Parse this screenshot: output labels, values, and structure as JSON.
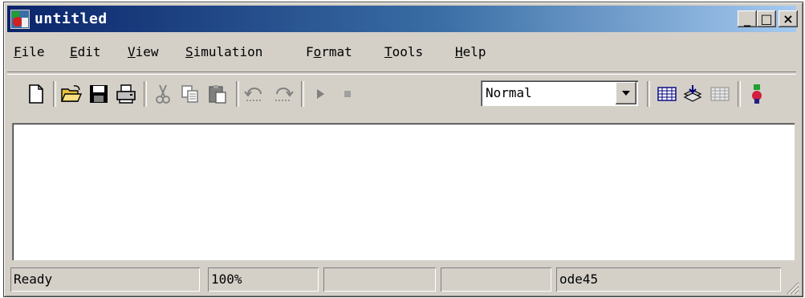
{
  "window": {
    "title": "untitled",
    "buttons": {
      "minimize": "_",
      "maximize": "□",
      "close": "×"
    }
  },
  "menubar": {
    "items": [
      {
        "prefix": "",
        "ul": "F",
        "rest": "ile"
      },
      {
        "prefix": "",
        "ul": "E",
        "rest": "dit"
      },
      {
        "prefix": "",
        "ul": "V",
        "rest": "iew"
      },
      {
        "prefix": "",
        "ul": "S",
        "rest": "imulation"
      },
      {
        "prefix": "F",
        "ul": "o",
        "rest": "rmat"
      },
      {
        "prefix": "",
        "ul": "T",
        "rest": "ools"
      },
      {
        "prefix": "",
        "ul": "H",
        "rest": "elp"
      }
    ]
  },
  "toolbar": {
    "icons": [
      "new-file-icon",
      "open-folder-icon",
      "save-icon",
      "print-icon",
      "cut-icon",
      "copy-icon",
      "paste-icon",
      "undo-icon",
      "redo-icon",
      "play-icon",
      "stop-icon",
      "library-icon",
      "build-icon",
      "update-diagram-icon",
      "simulink-library-icon"
    ],
    "sim_mode": "Normal"
  },
  "statusbar": {
    "status": "Ready",
    "zoom": "100%",
    "pane3": "",
    "pane4": "",
    "solver": "ode45"
  },
  "colors": {
    "titlebar_start": "#0a246a",
    "titlebar_end": "#a6caf0",
    "face": "#d4d0c8"
  }
}
